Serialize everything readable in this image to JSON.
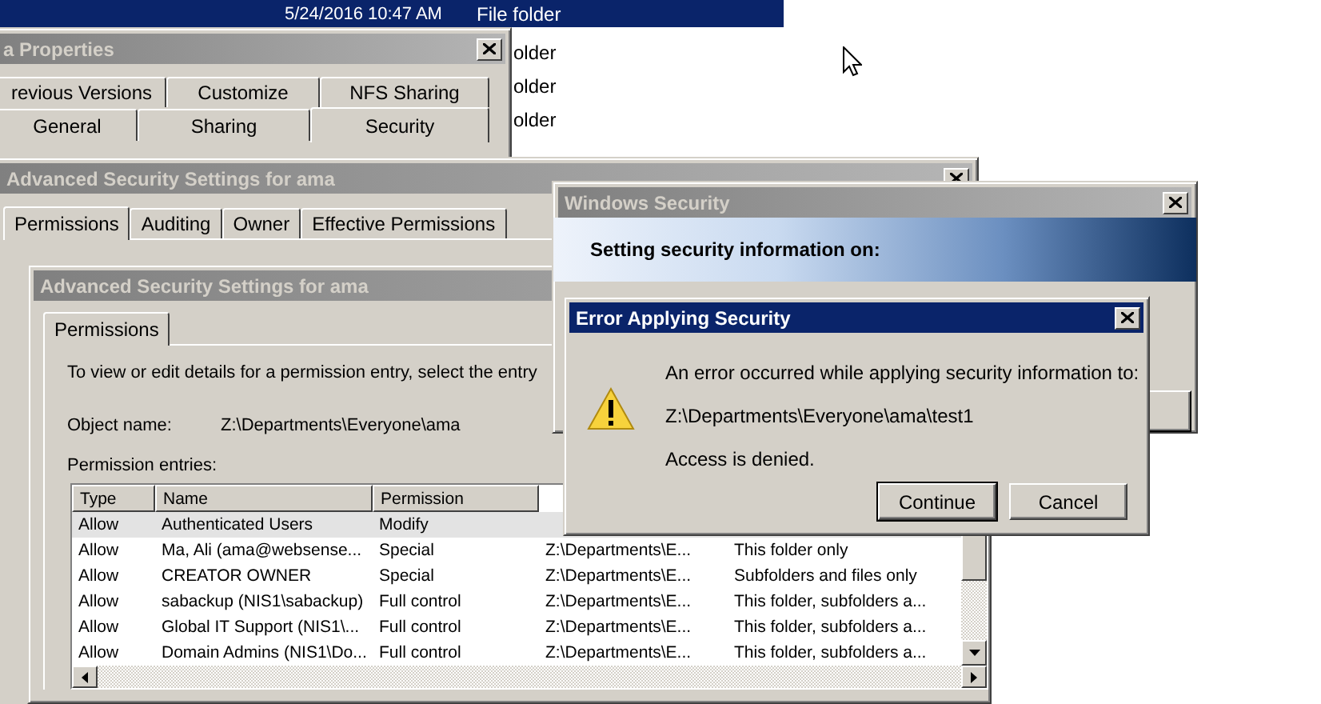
{
  "explorer": {
    "rows": [
      {
        "date": "5/24/2016 10:47 AM",
        "type": "File folder",
        "selected": true
      },
      {
        "type": "older",
        "selected": false
      },
      {
        "type": "older",
        "selected": false
      },
      {
        "type": "older",
        "selected": false
      }
    ]
  },
  "properties_window": {
    "title": "a Properties",
    "active": false,
    "tab_rows": [
      [
        {
          "label": "revious Versions",
          "selected": false
        },
        {
          "label": "Customize",
          "selected": false
        },
        {
          "label": "NFS Sharing",
          "selected": false
        }
      ],
      [
        {
          "label": "General",
          "selected": false
        },
        {
          "label": "Sharing",
          "selected": false
        },
        {
          "label": "Security",
          "selected": true
        }
      ]
    ]
  },
  "advanced_security_back": {
    "title": "Advanced Security Settings for ama",
    "active": false,
    "tabs": [
      {
        "label": "Permissions",
        "selected": true
      },
      {
        "label": "Auditing",
        "selected": false
      },
      {
        "label": "Owner",
        "selected": false
      },
      {
        "label": "Effective Permissions",
        "selected": false
      }
    ]
  },
  "advanced_security_front": {
    "title": "Advanced Security Settings for ama",
    "active": false,
    "tabs": [
      {
        "label": "Permissions",
        "selected": true
      }
    ],
    "instructions": "To view or edit details for a permission entry, select the entry",
    "object_name_label": "Object name:",
    "object_name": "Z:\\Departments\\Everyone\\ama",
    "entries_label": "Permission entries:",
    "table": {
      "columns": [
        "Type",
        "Name",
        "Permission"
      ],
      "rows": [
        {
          "cells": [
            "Allow",
            "Authenticated Users",
            "Modify"
          ],
          "selected": true
        },
        {
          "cells": [
            "Allow",
            "Ma, Ali (ama@websense...",
            "Special",
            "Z:\\Departments\\E...",
            "This folder only"
          ],
          "selected": false
        },
        {
          "cells": [
            "Allow",
            "CREATOR OWNER",
            "Special",
            "Z:\\Departments\\E...",
            "Subfolders and files only"
          ],
          "selected": false
        },
        {
          "cells": [
            "Allow",
            "sabackup (NIS1\\sabackup)",
            "Full control",
            "Z:\\Departments\\E...",
            "This folder, subfolders a..."
          ],
          "selected": false
        },
        {
          "cells": [
            "Allow",
            "Global IT Support (NIS1\\...",
            "Full control",
            "Z:\\Departments\\E...",
            "This folder, subfolders a..."
          ],
          "selected": false
        },
        {
          "cells": [
            "Allow",
            "Domain Admins (NIS1\\Do...",
            "Full control",
            "Z:\\Departments\\E...",
            "This folder, subfolders a..."
          ],
          "selected": false
        }
      ]
    }
  },
  "windows_security": {
    "title": "Windows Security",
    "active": false,
    "banner": "Setting security information on:"
  },
  "error_dialog": {
    "title": "Error Applying Security",
    "active": true,
    "messages": [
      "An error occurred while applying security information to:",
      "Z:\\Departments\\Everyone\\ama\\test1",
      "Access is denied."
    ],
    "buttons": [
      {
        "label": "Continue",
        "default": true
      },
      {
        "label": "Cancel",
        "default": false
      }
    ]
  }
}
